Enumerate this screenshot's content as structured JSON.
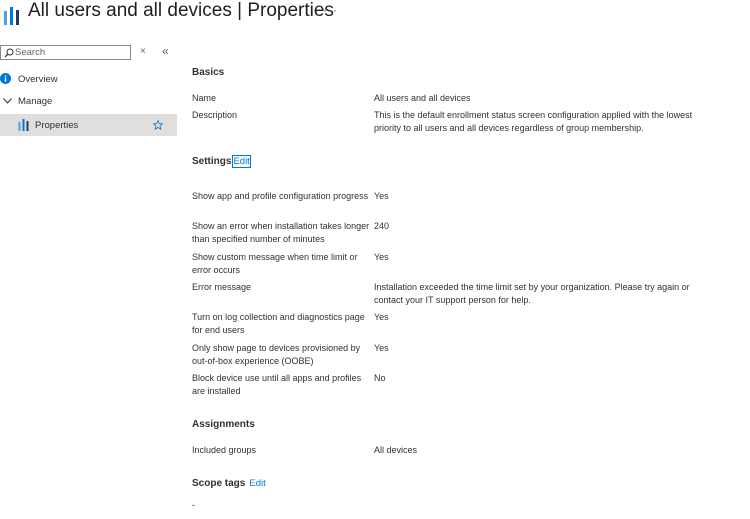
{
  "header": {
    "title_main": "All users and all devices",
    "title_sep": "|",
    "title_sub": "Properties",
    "more": "···"
  },
  "sidebar": {
    "search_placeholder": "Search",
    "clear_icon": "×",
    "collapse_icon": "«",
    "items": [
      {
        "label": "Overview"
      },
      {
        "label": "Manage"
      },
      {
        "label": "Properties"
      }
    ]
  },
  "basics": {
    "title": "Basics",
    "rows": [
      {
        "label": "Name",
        "value": "All users and all devices"
      },
      {
        "label": "Description",
        "value": "This is the default enrollment status screen configuration applied with the lowest priority to all users and all devices regardless of group membership."
      }
    ]
  },
  "settings": {
    "title": "Settings",
    "edit_label": "Edit",
    "rows": [
      {
        "label": "Show app and profile configuration progress",
        "value": "Yes"
      },
      {
        "label": "Show an error when installation takes longer than specified number of minutes",
        "value": "240"
      },
      {
        "label": "Show custom message when time limit or error occurs",
        "value": "Yes"
      },
      {
        "label": "Error message",
        "value": "Installation exceeded the time limit set by your organization. Please try again or contact your IT support person for help."
      },
      {
        "label": "Turn on log collection and diagnostics page for end users",
        "value": "Yes"
      },
      {
        "label": "Only show page to devices provisioned by out-of-box experience (OOBE)",
        "value": "Yes"
      },
      {
        "label": "Block device use until all apps and profiles are installed",
        "value": "No"
      }
    ]
  },
  "assignments": {
    "title": "Assignments",
    "rows": [
      {
        "label": "Included groups",
        "value": "All devices"
      }
    ]
  },
  "scope_tags": {
    "title": "Scope tags",
    "edit_label": "Edit",
    "value": "-"
  },
  "colors": {
    "accent": "#0078d4",
    "selected_bg": "#e1dfdd",
    "text": "#323130"
  }
}
